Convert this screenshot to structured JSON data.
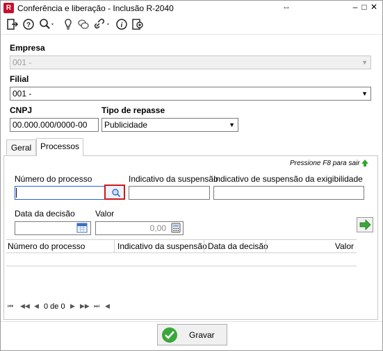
{
  "window": {
    "title": "Conferência e liberação - Inclusão R-2040",
    "app_icon_letter": "R",
    "minimize": "–",
    "maximize": "□",
    "close": "✕",
    "resize": "↔"
  },
  "toolbar": {
    "icons": [
      "exit-icon",
      "help-icon",
      "search-icon",
      "tip-icon",
      "chat-icon",
      "link-icon",
      "info-icon",
      "add-icon"
    ]
  },
  "form": {
    "empresa_label": "Empresa",
    "empresa_value": "001 -",
    "filial_label": "Filial",
    "filial_value": "001 -",
    "cnpj_label": "CNPJ",
    "cnpj_value": "00.000.000/0000-00",
    "tipo_repasse_label": "Tipo de repasse",
    "tipo_repasse_value": "Publicidade"
  },
  "tabs": [
    {
      "label": "Geral",
      "active": false
    },
    {
      "label": "Processos",
      "active": true
    }
  ],
  "processos": {
    "hint": "Pressione F8 para sair",
    "numero_label": "Número do processo",
    "numero_value": "",
    "indicativo_label": "Indicativo da suspensão",
    "indicativo_value": "",
    "exigibilidade_label": "Indicativo de suspensão da exigibilidade",
    "exigibilidade_value": "",
    "data_label": "Data da decisão",
    "data_value": "",
    "valor_label": "Valor",
    "valor_value": "0,00"
  },
  "grid": {
    "columns": [
      "Número do processo",
      "Indicativo da suspensão",
      "Data da decisão",
      "Valor"
    ],
    "rows": []
  },
  "pager": {
    "text": "0 de 0",
    "first": "⏮",
    "prev_page": "◀◀",
    "prev": "◀",
    "next": "▶",
    "next_page": "▶▶",
    "last": "⏭",
    "scroll_left": "◀"
  },
  "footer": {
    "save_label": "Gravar"
  },
  "colors": {
    "accent_red": "#c8102e",
    "green": "#3aa73a",
    "focus_border": "#2a5fd6"
  }
}
